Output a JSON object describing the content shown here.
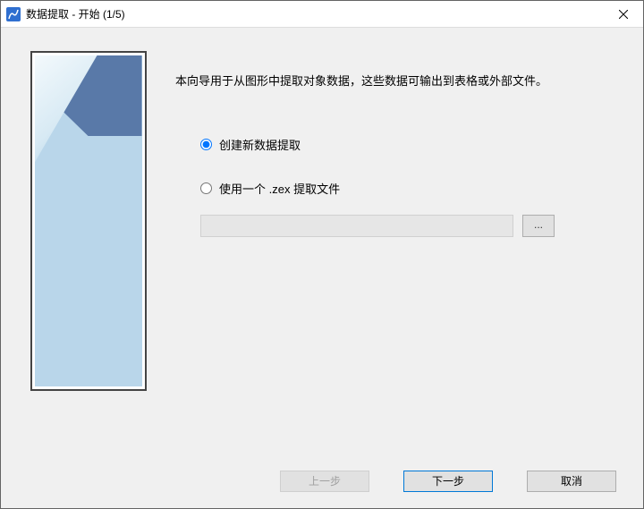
{
  "window": {
    "title": "数据提取 - 开始 (1/5)"
  },
  "intro": "本向导用于从图形中提取对象数据，这些数据可输出到表格或外部文件。",
  "options": {
    "create_new": "创建新数据提取",
    "use_file": "使用一个 .zex 提取文件",
    "file_value": "",
    "browse_label": "..."
  },
  "buttons": {
    "prev": "上一步",
    "next": "下一步",
    "cancel": "取消"
  }
}
